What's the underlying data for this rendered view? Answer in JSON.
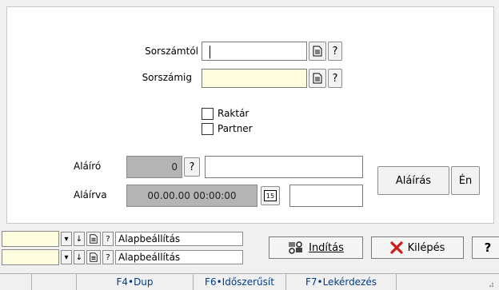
{
  "form": {
    "sorszamtol_label": "Sorszámtól",
    "sorszamig_label": "Sorszámig",
    "sorszamtol_value": "",
    "sorszamig_value": "",
    "q": "?",
    "raktar_label": "Raktár",
    "partner_label": "Partner",
    "alairo_label": "Aláíró",
    "alairo_value": "0",
    "alairva_label": "Aláírva",
    "alairva_value": "00.00.00 00:00:00",
    "calendar_text": "15",
    "alairas_button": "Aláírás",
    "en_button": "Én"
  },
  "bottom": {
    "preset1": "Alapbeállítás",
    "preset2": "Alapbeállítás",
    "q": "?",
    "inditas_button": "Indítás",
    "kilepes_button": "Kilépés",
    "help_button": "?"
  },
  "statusbar": {
    "f4": "F4•Dup",
    "f6": "F6•Időszerűsít",
    "f7": "F7•Lekérdezés"
  },
  "colors": {
    "yellow_field": "#fffde0",
    "disabled_field": "#b4b4b4",
    "close_icon": "#cc1a1a",
    "status_text": "#003c8a"
  }
}
